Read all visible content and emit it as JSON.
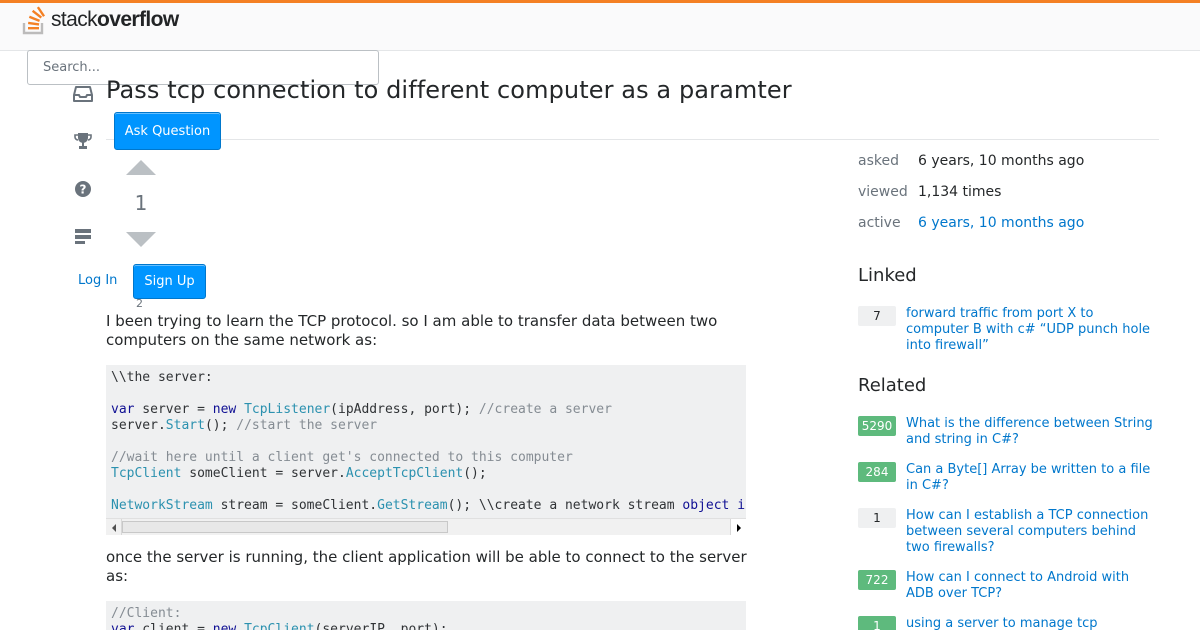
{
  "header": {
    "logo_text_light": "stack",
    "logo_text_bold": "overflow",
    "colors": {
      "accent": "#f48024",
      "link": "#0077cc",
      "button": "#0095ff",
      "answered": "#5eba7d"
    }
  },
  "search": {
    "placeholder": "Search..."
  },
  "question": {
    "title": "Pass tcp connection to different computer as a paramter",
    "votes": "1",
    "favorites": "2",
    "paragraph_1": "I been trying to learn the TCP protocol. so I am able to transfer data between two computers on the same network as:",
    "paragraph_2": "once the server is running, the client application will be able to connect to the server as:",
    "code_1": [
      "\\\\the server:",
      "",
      "var server = new TcpListener(ipAddress, port); //create a server",
      "server.Start(); //start the server",
      "",
      "//wait here until a client get's connected to this computer",
      "TcpClient someClient = server.AcceptTcpClient();",
      "",
      "NetworkStream stream = someClient.GetStream(); \\\\create a network stream object in"
    ],
    "code_2": [
      "//Client:",
      "var client = new TcpClient(serverIP, port);"
    ]
  },
  "left_nav": {
    "icons": [
      "inbox-icon",
      "trophy-icon",
      "help-icon",
      "review-queue-icon"
    ],
    "ask_question": "Ask Question",
    "log_in": "Log In",
    "sign_up": "Sign Up"
  },
  "stats": [
    {
      "label": "asked",
      "value": "6 years, 10 months ago"
    },
    {
      "label": "viewed",
      "value": "1,134 times"
    },
    {
      "label": "active",
      "value": "6 years, 10 months ago"
    }
  ],
  "linked": {
    "heading": "Linked",
    "items": [
      {
        "count": "7",
        "answered": false,
        "title": "forward traffic from port X to computer B with c# “UDP punch hole into firewall”"
      }
    ]
  },
  "related": {
    "heading": "Related",
    "items": [
      {
        "count": "5290",
        "answered": true,
        "title": "What is the difference between String and string in C#?"
      },
      {
        "count": "284",
        "answered": true,
        "title": "Can a Byte[] Array be written to a file in C#?"
      },
      {
        "count": "1",
        "answered": false,
        "title": "How can I establish a TCP connection between several computers behind two firewalls?"
      },
      {
        "count": "722",
        "answered": true,
        "title": "How can I connect to Android with ADB over TCP?"
      },
      {
        "count": "1",
        "answered": true,
        "title": "using a server to manage tcp"
      }
    ]
  }
}
